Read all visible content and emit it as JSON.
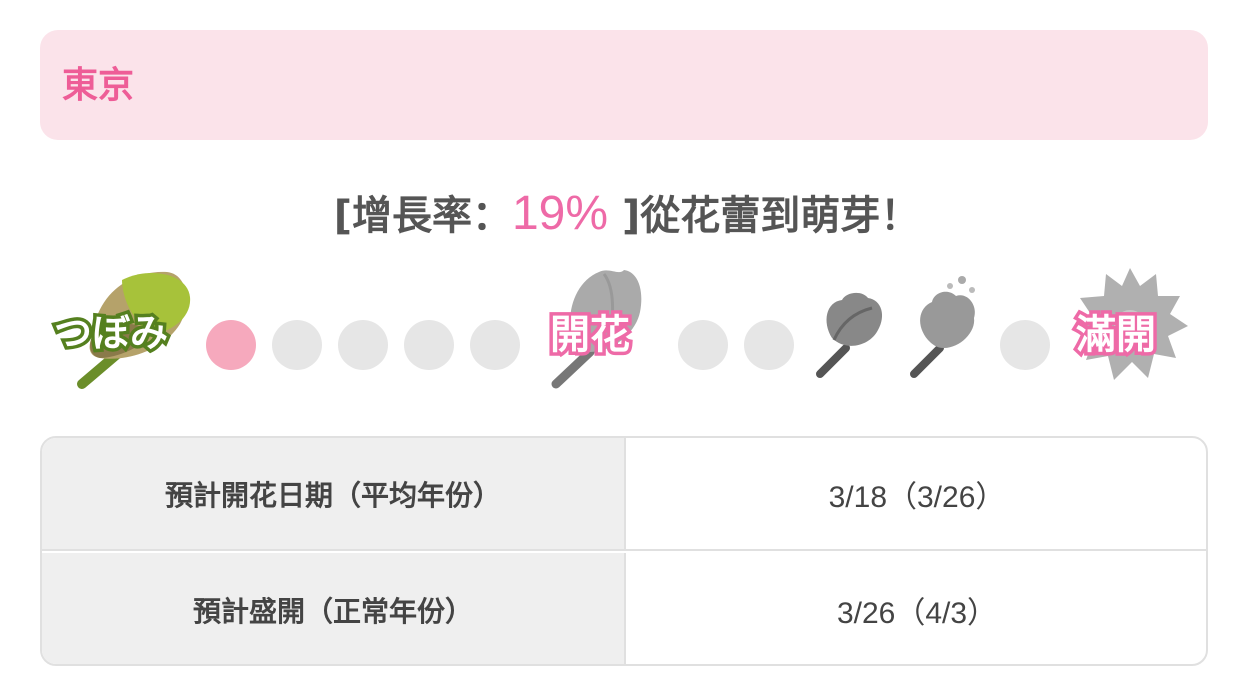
{
  "header": {
    "city": "東京"
  },
  "status": {
    "prefix": "[增長率：",
    "rate": "19%",
    "suffix": " ]從花蕾到萌芽！"
  },
  "progress": {
    "active_step": 1,
    "total_dots_between_bud_and_bloom": 5,
    "stages": [
      {
        "name": "bud",
        "label": "つぼみ"
      },
      {
        "name": "bloom",
        "label": "開花"
      },
      {
        "name": "full-bloom",
        "label": "滿開"
      }
    ],
    "colors": {
      "accent": "#ee6aa7",
      "active_dot": "#f6a9bd",
      "inactive_dot": "#e6e6e6",
      "bud_green": "#6b8e2a"
    }
  },
  "table": {
    "rows": [
      {
        "label": "預計開花日期（平均年份）",
        "value": "3/18（3/26）"
      },
      {
        "label": "預計盛開（正常年份）",
        "value": "3/26（4/3）"
      }
    ]
  }
}
